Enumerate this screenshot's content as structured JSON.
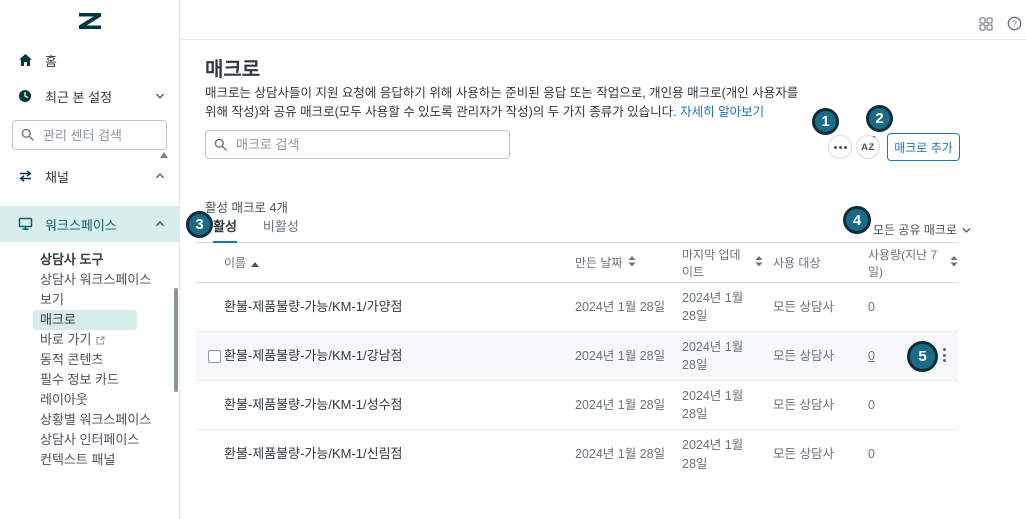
{
  "colors": {
    "accent_blue": "#1f73b7",
    "dark_teal": "#03363d",
    "selected_bg": "#d8ecec",
    "badge_fill": "#1a6c86",
    "badge_border": "#0c2e38",
    "row_hover_bg": "#f7f8f9",
    "text_gray": "#68737d",
    "text_dark": "#2f3941"
  },
  "icons": {
    "logo": "zendesk-logo",
    "home": "home-icon",
    "recent": "clock-icon",
    "sidebar_search": "search-icon",
    "channels": "swap-arrows-icon",
    "workspace": "monitor-icon",
    "shortcut": "external-link-icon",
    "collapse": "chevron-up-icon",
    "expand": "chevron-down-icon",
    "apps": "apps-grid-icon",
    "help": "help-icon",
    "overflow": "ellipsis-icon",
    "sort_az": "sort-az-icon",
    "row_menu": "kebab-icon",
    "sort_asc": "caret-up-icon",
    "sort_both": "caret-updown-icon"
  },
  "sidebar": {
    "home": "홈",
    "recent": "최근 본 설정",
    "search_placeholder": "관리 센터 검색",
    "channels": "채널",
    "workspace": "워크스페이스",
    "workspace_items": [
      {
        "label": "상담사 도구"
      },
      {
        "label": "상담사 워크스페이스"
      },
      {
        "label": "보기"
      },
      {
        "label": "매크로"
      },
      {
        "label": "바로 가기"
      },
      {
        "label": "동적 콘텐츠"
      },
      {
        "label": "필수 정보 카드"
      },
      {
        "label": "레이아웃"
      },
      {
        "label": "상황별 워크스페이스"
      },
      {
        "label": "상담사 인터페이스"
      },
      {
        "label": "컨텍스트 패널"
      }
    ]
  },
  "main": {
    "title": "매크로",
    "description": [
      "매크로는 상담사들이 지원 요청에 응답하기 위해 사용하는 준비된 응답 또는 작업으로, 개인용 매크로(개인 사용자를 위해 작성)와 공유 매크로(모두",
      "사용할 수 있도록 관리자가 작성)의 두 가지 종류가 있습니다."
    ],
    "learn_more": "자세히 알아보기",
    "search_placeholder": "매크로 검색",
    "az_button": "AZ",
    "add_button": "매크로 추가",
    "count_label": "활성 매크로 4개",
    "tabs": [
      {
        "label": "활성",
        "active": true
      },
      {
        "label": "비활성",
        "active": false
      }
    ],
    "filter_dropdown": "모든 공유 매크로",
    "table": {
      "columns": [
        {
          "label": "이름",
          "sort": "asc"
        },
        {
          "label": "만든 날짜",
          "sort": "both"
        },
        {
          "label": "마지막 업데이트",
          "sort": "both"
        },
        {
          "label": "사용 대상",
          "sort": "none"
        },
        {
          "label": "사용량(지난 7일)",
          "sort": "both"
        }
      ],
      "rows": [
        {
          "name": "환불-제품불량-가능/KM-1/가양점",
          "created": "2024년 1월 28일",
          "updated": "2024년 1월 28일",
          "target": "모든 상담사",
          "usage": "0"
        },
        {
          "name": "환불-제품불량-가능/KM-1/강남점",
          "created": "2024년 1월 28일",
          "updated": "2024년 1월 28일",
          "target": "모든 상담사",
          "usage": "0"
        },
        {
          "name": "환불-제품불량-가능/KM-1/성수점",
          "created": "2024년 1월 28일",
          "updated": "2024년 1월 28일",
          "target": "모든 상담사",
          "usage": "0"
        },
        {
          "name": "환불-제품불량-가능/KM-1/신림점",
          "created": "2024년 1월 28일",
          "updated": "2024년 1월 28일",
          "target": "모든 상담사",
          "usage": "0"
        }
      ]
    }
  },
  "annotations": [
    {
      "n": "1"
    },
    {
      "n": "2"
    },
    {
      "n": "3"
    },
    {
      "n": "4"
    },
    {
      "n": "5"
    }
  ]
}
